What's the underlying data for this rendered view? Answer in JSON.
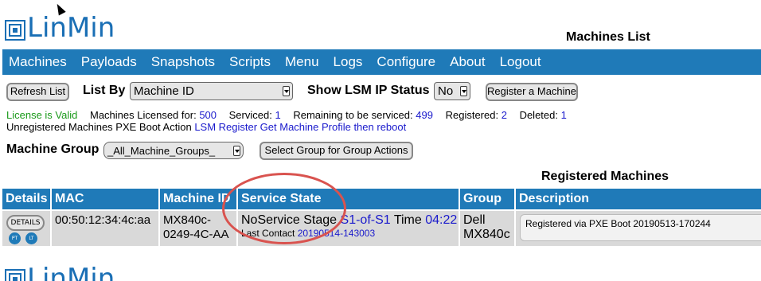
{
  "brand": {
    "logo_text": "LinMin",
    "logo_box": "LM"
  },
  "page_title": "Machines List",
  "nav": [
    "Machines",
    "Payloads",
    "Snapshots",
    "Scripts",
    "Menu",
    "Logs",
    "Configure",
    "About",
    "Logout"
  ],
  "toolbar": {
    "refresh_label": "Refresh List",
    "list_by_label": "List By",
    "list_by_value": "Machine ID",
    "show_lsm_label": "Show LSM IP Status",
    "show_lsm_value": "No",
    "register_label": "Register a Machine"
  },
  "status": {
    "license": "License is Valid",
    "licensed_label": "Machines Licensed for:",
    "licensed_value": "500",
    "serviced_label": "Serviced:",
    "serviced_value": "1",
    "remaining_label": "Remaining to be serviced:",
    "remaining_value": "499",
    "registered_label": "Registered:",
    "registered_value": "2",
    "deleted_label": "Deleted:",
    "deleted_value": "1",
    "pxe_label": "Unregistered Machines PXE Boot Action",
    "pxe_value": "LSM Register Get Machine Profile then reboot"
  },
  "group": {
    "label": "Machine Group",
    "value": "_All_Machine_Groups_",
    "select_btn": "Select Group for Group Actions"
  },
  "registered_title": "Registered Machines",
  "table": {
    "headers": [
      "Details",
      "MAC",
      "Machine ID",
      "Service State",
      "Group",
      "Description"
    ],
    "row": {
      "details_btn": "DETAILS",
      "pt": "PT",
      "lt": "LT",
      "mac": "00:50:12:34:4c:aa",
      "machine_id_1": "MX840c-",
      "machine_id_2": "0249-4C-AA",
      "state_prefix": "NoService Stage",
      "stage": "S1-of-S1",
      "time_label": "Time",
      "time_value": "04:22",
      "last_contact_label": "Last Contact",
      "last_contact_value": "20190514-143003",
      "group_1": "Dell",
      "group_2": "MX840c",
      "description": "Registered via PXE Boot 20190513-170244"
    }
  },
  "colors": {
    "accent": "#1f7ab8",
    "highlight_circle": "#d9534f",
    "valid": "#1a9a1a",
    "link": "#1a1acc"
  }
}
